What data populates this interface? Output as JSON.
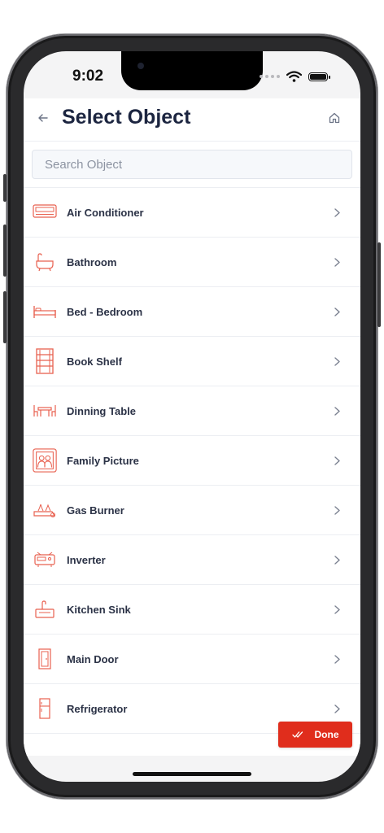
{
  "status_bar": {
    "time": "9:02"
  },
  "header": {
    "title": "Select Object"
  },
  "search": {
    "placeholder": "Search Object",
    "value": ""
  },
  "objects": [
    {
      "label": "Air Conditioner",
      "icon": "air-conditioner-icon"
    },
    {
      "label": "Bathroom",
      "icon": "bathtub-icon"
    },
    {
      "label": "Bed - Bedroom",
      "icon": "bed-icon"
    },
    {
      "label": "Book Shelf",
      "icon": "bookshelf-icon"
    },
    {
      "label": "Dinning Table",
      "icon": "dining-table-icon"
    },
    {
      "label": "Family Picture",
      "icon": "family-picture-icon"
    },
    {
      "label": "Gas Burner",
      "icon": "gas-burner-icon"
    },
    {
      "label": "Inverter",
      "icon": "inverter-icon"
    },
    {
      "label": "Kitchen Sink",
      "icon": "kitchen-sink-icon"
    },
    {
      "label": "Main Door",
      "icon": "door-icon"
    },
    {
      "label": "Refrigerator",
      "icon": "refrigerator-icon"
    }
  ],
  "footer": {
    "done_label": "Done"
  },
  "colors": {
    "accent": "#e02d1c",
    "icon_stroke": "#e8604f",
    "title": "#1c2540"
  }
}
